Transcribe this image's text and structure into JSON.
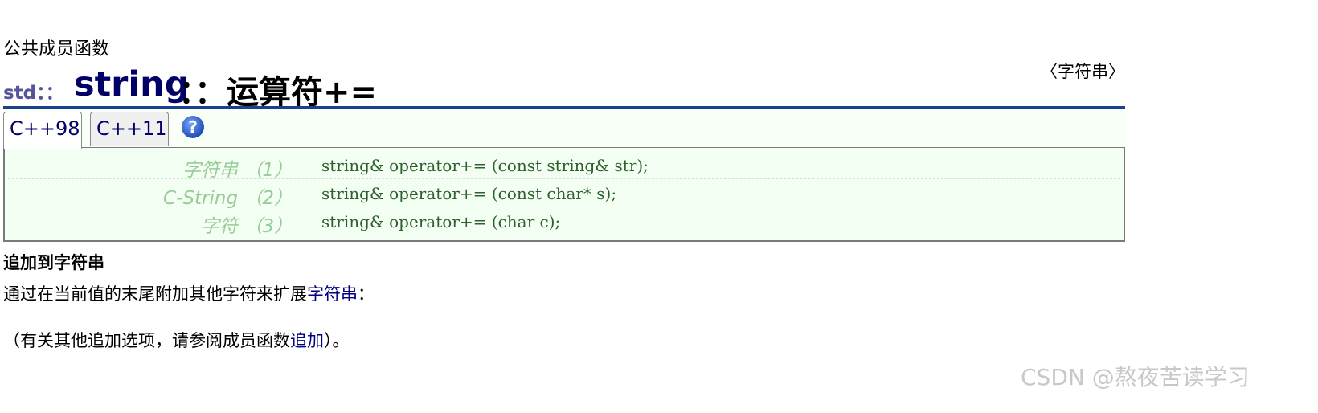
{
  "header": {
    "kicker": "公共成员函数",
    "title_ns": "std：：",
    "title_main": "string",
    "title_op": "：：运算符+=",
    "header_link": "〈字符串〉"
  },
  "tabs": [
    {
      "label": "C++98",
      "active": true
    },
    {
      "label": "C++11",
      "active": false
    }
  ],
  "help_icon": "help-circle-icon",
  "declarations": [
    {
      "label": "字符串 （1）",
      "code": "string& operator+= (const string& str);"
    },
    {
      "label": "C-String （2）",
      "code": "string& operator+= (const char* s);"
    },
    {
      "label": "字符 （3）",
      "code": "string& operator+= (char c);"
    }
  ],
  "content": {
    "subtitle": "追加到字符串",
    "p1_text": "通过在当前值的末尾附加其他字符来扩展",
    "p1_link": "字符串",
    "p1_tail": "：",
    "p2_prefix": "（有关其他追加选项，请参阅成员函数",
    "p2_link": "追加",
    "p2_suffix": "）。"
  },
  "watermark": "CSDN @熬夜苦读学习",
  "colors": {
    "title_navy": "#000066",
    "rule_blue": "#1d3f8f",
    "decl_bg": "#f4fff4",
    "label_green": "#99cc99",
    "code_green": "#2f5f2f",
    "link": "#000080"
  }
}
